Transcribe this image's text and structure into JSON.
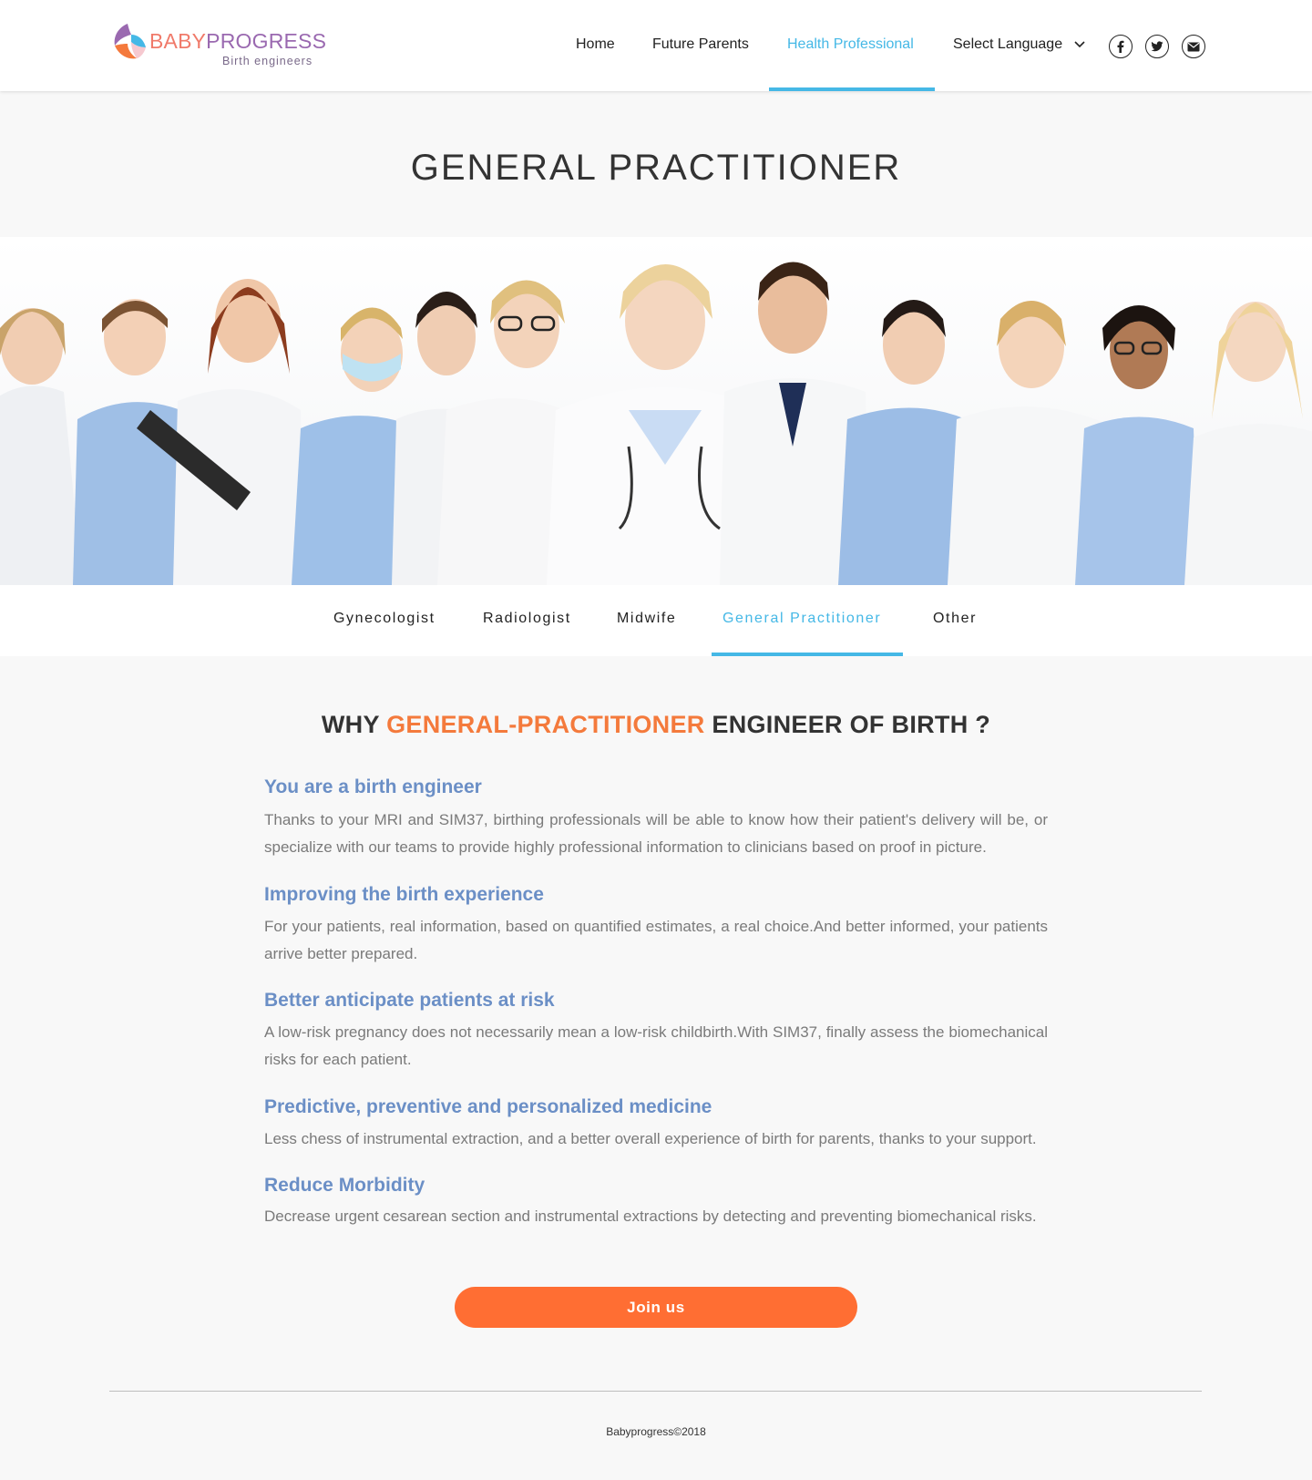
{
  "brand": {
    "word_a": "BABY",
    "word_b": "PROGRESS",
    "tagline": "Birth engineers",
    "colors": {
      "coral": "#f07a6a",
      "purple": "#9a69b0",
      "blue": "#45b8e6",
      "orange": "#ff6e33"
    }
  },
  "nav": {
    "items": [
      {
        "label": "Home",
        "active": false
      },
      {
        "label": "Future Parents",
        "active": false
      },
      {
        "label": "Health Professional",
        "active": true
      },
      {
        "label": "Select Language",
        "active": false,
        "dropdown": true
      }
    ],
    "social": [
      "facebook-icon",
      "twitter-icon",
      "mail-icon"
    ]
  },
  "hero": {
    "title": "GENERAL PRACTITIONER",
    "image": "group of smiling doctors and nurses in white coats and blue scrubs with stethoscopes"
  },
  "tabs": [
    {
      "label": "Gynecologist",
      "active": false
    },
    {
      "label": "Radiologist",
      "active": false
    },
    {
      "label": "Midwife",
      "active": false
    },
    {
      "label": "General Practitioner",
      "active": true
    },
    {
      "label": "Other",
      "active": false
    }
  ],
  "why": {
    "prefix": "WHY ",
    "highlight": "GENERAL-PRACTITIONER",
    "suffix": " ENGINEER OF BIRTH ?"
  },
  "features": [
    {
      "title": "You are a birth engineer",
      "text": "Thanks to your MRI and SIM37, birthing professionals will be able to know how their patient's delivery will be, or specialize with our teams to provide highly professional information to clinicians based on proof in picture."
    },
    {
      "title": "Improving the birth experience",
      "text": "For your patients, real information, based on quantified estimates, a real choice.And better informed, your patients arrive better prepared."
    },
    {
      "title": "Better anticipate patients at risk",
      "text": "A low-risk pregnancy does not necessarily mean a low-risk childbirth.With SIM37, finally assess the biomechanical risks for each patient."
    },
    {
      "title": "Predictive, preventive and personalized medicine",
      "text": "Less chess of instrumental extraction, and a better overall experience of birth for parents, thanks to your support."
    },
    {
      "title": "Reduce Morbidity",
      "text": "Decrease urgent cesarean section and instrumental extractions by detecting and preventing biomechanical risks."
    }
  ],
  "cta": {
    "label": "Join us"
  },
  "footer": {
    "copyright": "Babyprogress©2018"
  }
}
